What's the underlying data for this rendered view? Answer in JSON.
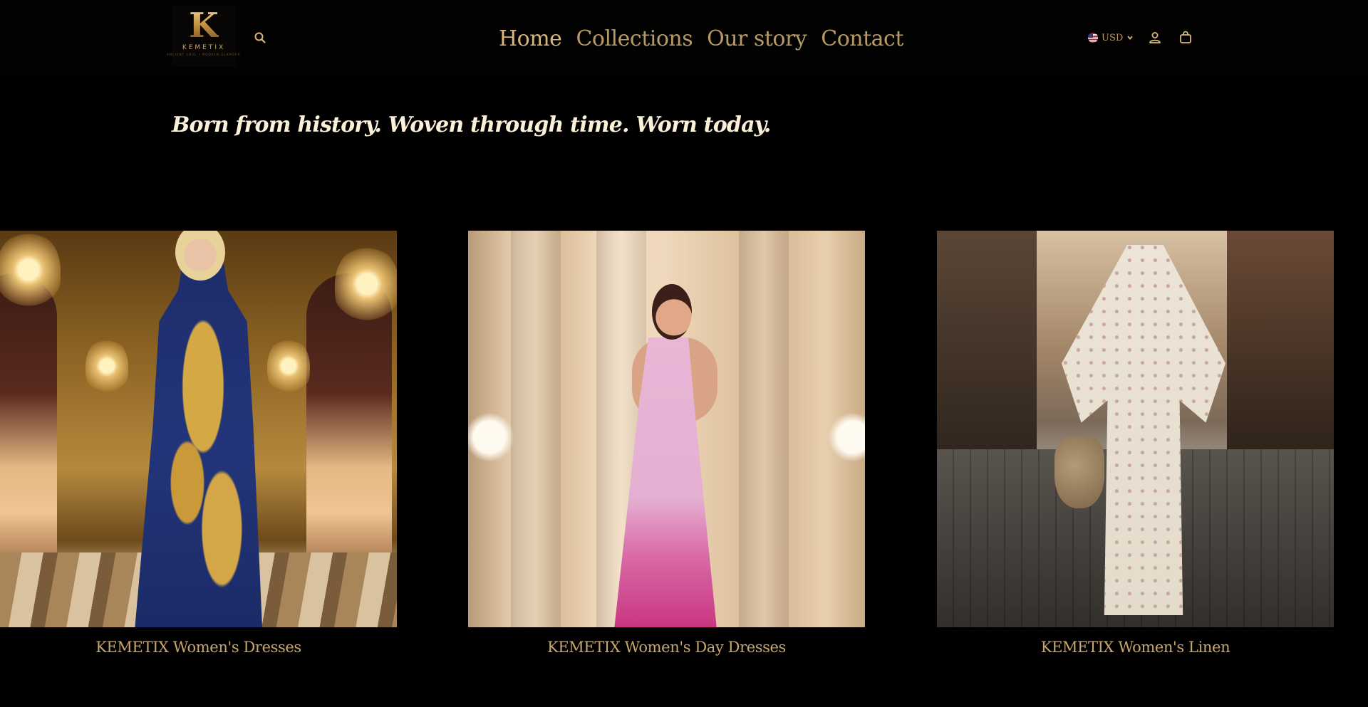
{
  "header": {
    "logo": {
      "letter": "K",
      "wordmark": "KEMETIX",
      "tagline": "ANCIENT SOUL • MODERN GLAMOUR"
    },
    "nav": [
      {
        "label": "Home",
        "active": true
      },
      {
        "label": "Collections",
        "active": false
      },
      {
        "label": "Our story",
        "active": false
      },
      {
        "label": "Contact",
        "active": false
      }
    ],
    "currency": "USD",
    "icons": {
      "search": "search-icon",
      "account": "account-icon",
      "cart": "cart-icon",
      "flag": "us-flag-icon",
      "dropdown": "chevron-down-icon"
    }
  },
  "hero": {
    "tagline": "Born from history. Woven through time. Worn today."
  },
  "collections": [
    {
      "title": "KEMETIX Women's Dresses"
    },
    {
      "title": "KEMETIX Women's Day Dresses"
    },
    {
      "title": "KEMETIX Women's Linen"
    }
  ],
  "colors": {
    "background": "#000000",
    "accent_gold": "#c9a76a",
    "tagline_cream": "#fbf0d8"
  }
}
